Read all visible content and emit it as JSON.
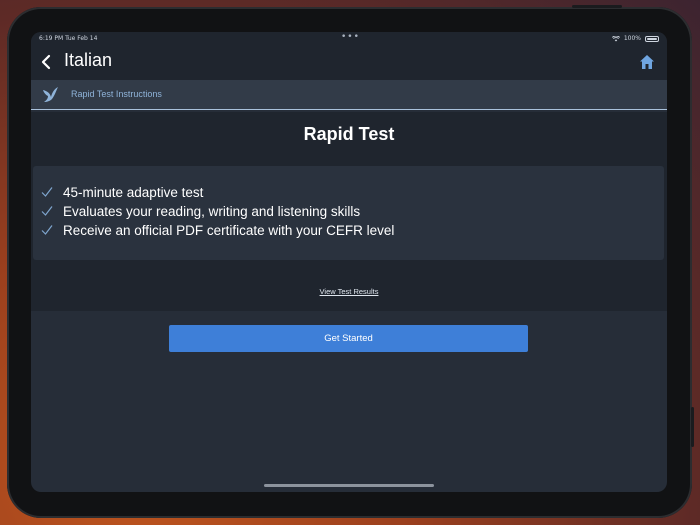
{
  "status_bar": {
    "time_date": "6:19 PM  Tue Feb 14",
    "battery": "100%"
  },
  "navbar": {
    "title": "Italian"
  },
  "subnav": {
    "label": "Rapid Test Instructions"
  },
  "card": {
    "title": "Rapid Test",
    "features": [
      "45-minute adaptive test",
      "Evaluates your reading, writing and listening skills",
      "Receive an official PDF certificate with your CEFR level"
    ],
    "view_results_label": "View Test Results"
  },
  "cta": {
    "label": "Get Started"
  },
  "colors": {
    "accent": "#3e7fd8",
    "check": "#7fa6cf",
    "link": "#8fb3d9",
    "background": "#262d38"
  },
  "icons": {
    "back": "chevron-left-icon",
    "home": "home-icon",
    "brand": "bird-icon",
    "feature": "check-icon"
  }
}
